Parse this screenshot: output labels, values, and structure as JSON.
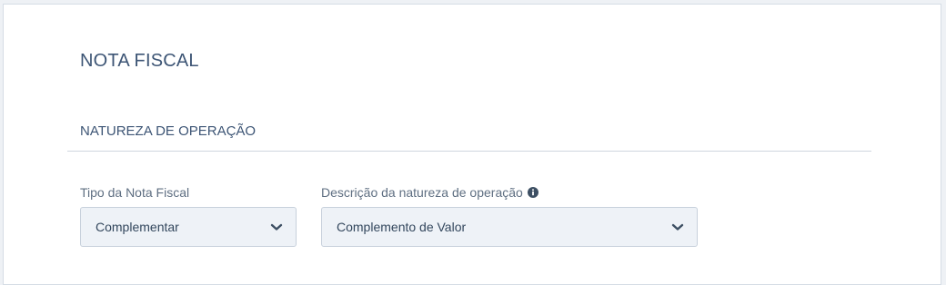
{
  "page": {
    "title": "NOTA FISCAL"
  },
  "section": {
    "title": "NATUREZA DE OPERAÇÃO"
  },
  "fields": {
    "tipo": {
      "label": "Tipo da Nota Fiscal",
      "value": "Complementar"
    },
    "descricao": {
      "label": "Descrição da natureza de operação",
      "value": "Complemento de Valor"
    }
  },
  "icons": {
    "info": "info-icon",
    "chevron": "chevron-down-icon"
  },
  "colors": {
    "heading": "#3d5575",
    "label": "#5f6f82",
    "select_bg": "#eef2f7",
    "select_border": "#c8d1dc",
    "divider": "#cfd6df"
  }
}
